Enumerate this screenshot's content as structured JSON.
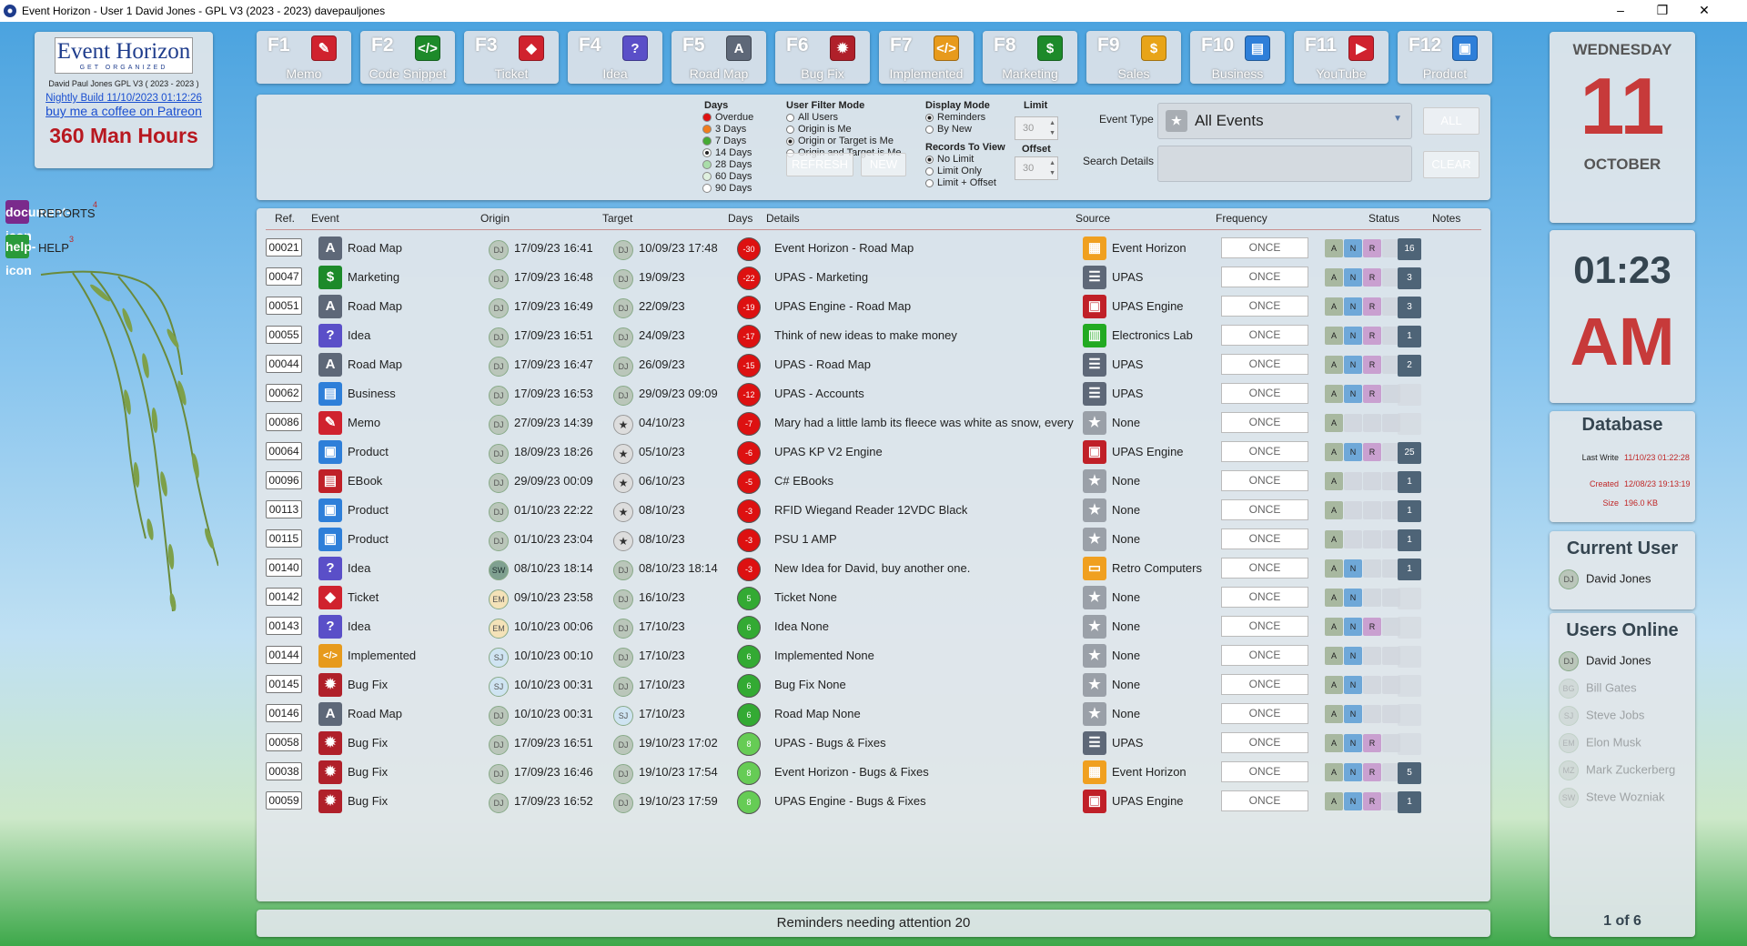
{
  "window": {
    "title": "Event Horizon - User 1 David Jones - GPL V3 (2023 - 2023) davepauljones"
  },
  "logo": {
    "title": "Event Horizon",
    "tagline": "GET ORGANIZED",
    "license": "David Paul Jones GPL V3 ( 2023 - 2023 )",
    "nightly": "Nightly Build 11/10/2023 01:12:26",
    "patreon": "buy me a coffee on Patreon",
    "hours": "360 Man Hours"
  },
  "leftnav": [
    {
      "label": "REPORTS",
      "count": "4",
      "color": "#7a2a8c",
      "icon": "document-icon"
    },
    {
      "label": "HELP",
      "count": "3",
      "color": "#2a9a3a",
      "icon": "help-icon"
    }
  ],
  "fkeys": [
    {
      "key": "F1",
      "label": "Memo",
      "color": "#d0222e",
      "glyph": "✎"
    },
    {
      "key": "F2",
      "label": "Code Snippet",
      "color": "#1d8a2a",
      "glyph": "</>"
    },
    {
      "key": "F3",
      "label": "Ticket",
      "color": "#d0222e",
      "glyph": "◆"
    },
    {
      "key": "F4",
      "label": "Idea",
      "color": "#5a4fc8",
      "glyph": "?"
    },
    {
      "key": "F5",
      "label": "Road Map",
      "color": "#5e6878",
      "glyph": "A"
    },
    {
      "key": "F6",
      "label": "Bug Fix",
      "color": "#b0202a",
      "glyph": "✹"
    },
    {
      "key": "F7",
      "label": "Implemented",
      "color": "#e79a1c",
      "glyph": "</>"
    },
    {
      "key": "F8",
      "label": "Marketing",
      "color": "#1d8a2a",
      "glyph": "$"
    },
    {
      "key": "F9",
      "label": "Sales",
      "color": "#e8a418",
      "glyph": "$"
    },
    {
      "key": "F10",
      "label": "Business",
      "color": "#2e7fd9",
      "glyph": "▤"
    },
    {
      "key": "F11",
      "label": "YouTube",
      "color": "#d0222e",
      "glyph": "▶"
    },
    {
      "key": "F12",
      "label": "Product",
      "color": "#2e7fd9",
      "glyph": "▣"
    }
  ],
  "filters": {
    "days_title": "Days",
    "days": [
      {
        "label": "Overdue",
        "color": "#dd1111"
      },
      {
        "label": "3 Days",
        "color": "#f07c1c"
      },
      {
        "label": "7 Days",
        "color": "#44aa33"
      },
      {
        "label": "14 Days",
        "color": "#66cc55",
        "selected": true
      },
      {
        "label": "28 Days",
        "color": "#aaddaa"
      },
      {
        "label": "60 Days",
        "color": "#dff0df"
      },
      {
        "label": "90 Days",
        "color": "#ffffff"
      }
    ],
    "user_filter_title": "User Filter Mode",
    "user_filter": [
      {
        "label": "All Users"
      },
      {
        "label": "Origin is Me"
      },
      {
        "label": "Origin or Target is Me",
        "selected": true
      },
      {
        "label": "Origin and Target is Me"
      }
    ],
    "display_title": "Display Mode",
    "display": [
      {
        "label": "Reminders",
        "selected": true
      },
      {
        "label": "By New"
      }
    ],
    "records_title": "Records To View",
    "records": [
      {
        "label": "No Limit",
        "selected": true
      },
      {
        "label": "Limit Only"
      },
      {
        "label": "Limit + Offset"
      }
    ],
    "limit_title": "Limit",
    "limit_value": "30",
    "offset_title": "Offset",
    "offset_value": "30",
    "refresh": "REFRESH",
    "new": "NEW",
    "event_type_label": "Event Type",
    "event_type_value": "All Events",
    "all_button": "ALL",
    "search_label": "Search Details",
    "search_value": "",
    "clear_button": "CLEAR"
  },
  "columns": [
    "Ref.",
    "Event",
    "Origin",
    "Target",
    "Days",
    "Details",
    "Source",
    "Frequency",
    "Status",
    "Notes"
  ],
  "rows": [
    {
      "ref": "00021",
      "event": "Road Map",
      "ecol": "#5e6878",
      "eg": "A",
      "origin": "17/09/23 16:41",
      "oav": "DJ",
      "target": "10/09/23 17:48",
      "tav": "DJ",
      "days": "-30",
      "dcol": "#dd1111",
      "details": "Event Horizon - Road Map",
      "source": "Event Horizon",
      "scol": "#f0a020",
      "sg": "▦",
      "freq": "ONCE",
      "a": 1,
      "n": 1,
      "r": 1,
      "notes": "16"
    },
    {
      "ref": "00047",
      "event": "Marketing",
      "ecol": "#1d8a2a",
      "eg": "$",
      "origin": "17/09/23 16:48",
      "oav": "DJ",
      "target": "19/09/23",
      "tav": "DJ",
      "days": "-22",
      "dcol": "#dd1111",
      "details": "UPAS - Marketing",
      "source": "UPAS",
      "scol": "#5e6878",
      "sg": "☰",
      "freq": "ONCE",
      "a": 1,
      "n": 1,
      "r": 1,
      "notes": "3"
    },
    {
      "ref": "00051",
      "event": "Road Map",
      "ecol": "#5e6878",
      "eg": "A",
      "origin": "17/09/23 16:49",
      "oav": "DJ",
      "target": "22/09/23",
      "tav": "DJ",
      "days": "-19",
      "dcol": "#dd1111",
      "details": "UPAS Engine - Road Map",
      "source": "UPAS Engine",
      "scol": "#c02028",
      "sg": "▣",
      "freq": "ONCE",
      "a": 1,
      "n": 1,
      "r": 1,
      "notes": "3"
    },
    {
      "ref": "00055",
      "event": "Idea",
      "ecol": "#5a4fc8",
      "eg": "?",
      "origin": "17/09/23 16:51",
      "oav": "DJ",
      "target": "24/09/23",
      "tav": "DJ",
      "days": "-17",
      "dcol": "#dd1111",
      "details": "Think of new ideas to make money",
      "source": "Electronics Lab",
      "scol": "#22aa22",
      "sg": "▥",
      "freq": "ONCE",
      "a": 1,
      "n": 1,
      "r": 1,
      "notes": "1"
    },
    {
      "ref": "00044",
      "event": "Road Map",
      "ecol": "#5e6878",
      "eg": "A",
      "origin": "17/09/23 16:47",
      "oav": "DJ",
      "target": "26/09/23",
      "tav": "DJ",
      "days": "-15",
      "dcol": "#dd1111",
      "details": "UPAS - Road Map",
      "source": "UPAS",
      "scol": "#5e6878",
      "sg": "☰",
      "freq": "ONCE",
      "a": 1,
      "n": 1,
      "r": 1,
      "notes": "2"
    },
    {
      "ref": "00062",
      "event": "Business",
      "ecol": "#2e7fd9",
      "eg": "▤",
      "origin": "17/09/23 16:53",
      "oav": "DJ",
      "target": "29/09/23 09:09",
      "tav": "DJ",
      "days": "-12",
      "dcol": "#dd1111",
      "details": "UPAS - Accounts",
      "source": "UPAS",
      "scol": "#5e6878",
      "sg": "☰",
      "freq": "ONCE",
      "a": 1,
      "n": 1,
      "r": 1,
      "notes": ""
    },
    {
      "ref": "00086",
      "event": "Memo",
      "ecol": "#d0222e",
      "eg": "✎",
      "origin": "27/09/23 14:39",
      "oav": "DJ",
      "target": "04/10/23",
      "tav": "★",
      "days": "-7",
      "dcol": "#dd1111",
      "details": "Mary had a little lamb its fleece was white as snow, every",
      "source": "None",
      "scol": "#9aa0a8",
      "sg": "★",
      "freq": "ONCE",
      "a": 1,
      "n": 0,
      "r": 0,
      "notes": ""
    },
    {
      "ref": "00064",
      "event": "Product",
      "ecol": "#2e7fd9",
      "eg": "▣",
      "origin": "18/09/23 18:26",
      "oav": "DJ",
      "target": "05/10/23",
      "tav": "★",
      "days": "-6",
      "dcol": "#dd1111",
      "details": "UPAS KP V2 Engine",
      "source": "UPAS Engine",
      "scol": "#c02028",
      "sg": "▣",
      "freq": "ONCE",
      "a": 1,
      "n": 1,
      "r": 1,
      "notes": "25"
    },
    {
      "ref": "00096",
      "event": "EBook",
      "ecol": "#c02028",
      "eg": "▤",
      "origin": "29/09/23 00:09",
      "oav": "DJ",
      "target": "06/10/23",
      "tav": "★",
      "days": "-5",
      "dcol": "#dd1111",
      "details": "C# EBooks",
      "source": "None",
      "scol": "#9aa0a8",
      "sg": "★",
      "freq": "ONCE",
      "a": 1,
      "n": 0,
      "r": 0,
      "notes": "1"
    },
    {
      "ref": "00113",
      "event": "Product",
      "ecol": "#2e7fd9",
      "eg": "▣",
      "origin": "01/10/23 22:22",
      "oav": "DJ",
      "target": "08/10/23",
      "tav": "★",
      "days": "-3",
      "dcol": "#dd1111",
      "details": "RFID Wiegand Reader 12VDC Black",
      "source": "None",
      "scol": "#9aa0a8",
      "sg": "★",
      "freq": "ONCE",
      "a": 1,
      "n": 0,
      "r": 0,
      "notes": "1"
    },
    {
      "ref": "00115",
      "event": "Product",
      "ecol": "#2e7fd9",
      "eg": "▣",
      "origin": "01/10/23 23:04",
      "oav": "DJ",
      "target": "08/10/23",
      "tav": "★",
      "days": "-3",
      "dcol": "#dd1111",
      "details": "PSU 1 AMP",
      "source": "None",
      "scol": "#9aa0a8",
      "sg": "★",
      "freq": "ONCE",
      "a": 1,
      "n": 0,
      "r": 0,
      "notes": "1"
    },
    {
      "ref": "00140",
      "event": "Idea",
      "ecol": "#5a4fc8",
      "eg": "?",
      "origin": "08/10/23 18:14",
      "oav": "SW",
      "target": "08/10/23 18:14",
      "tav": "DJ",
      "days": "-3",
      "dcol": "#dd1111",
      "details": "New Idea for David, buy another one.",
      "source": "Retro Computers",
      "scol": "#f0a020",
      "sg": "▭",
      "freq": "ONCE",
      "a": 1,
      "n": 1,
      "r": 0,
      "notes": "1"
    },
    {
      "ref": "00142",
      "event": "Ticket",
      "ecol": "#d0222e",
      "eg": "◆",
      "origin": "09/10/23 23:58",
      "oav": "EM",
      "target": "16/10/23",
      "tav": "DJ",
      "days": "5",
      "dcol": "#33aa33",
      "details": "Ticket None",
      "source": "None",
      "scol": "#9aa0a8",
      "sg": "★",
      "freq": "ONCE",
      "a": 1,
      "n": 1,
      "r": 0,
      "notes": ""
    },
    {
      "ref": "00143",
      "event": "Idea",
      "ecol": "#5a4fc8",
      "eg": "?",
      "origin": "10/10/23 00:06",
      "oav": "EM",
      "target": "17/10/23",
      "tav": "DJ",
      "days": "6",
      "dcol": "#33aa33",
      "details": "Idea None",
      "source": "None",
      "scol": "#9aa0a8",
      "sg": "★",
      "freq": "ONCE",
      "a": 1,
      "n": 1,
      "r": 1,
      "notes": ""
    },
    {
      "ref": "00144",
      "event": "Implemented",
      "ecol": "#e79a1c",
      "eg": "</>",
      "origin": "10/10/23 00:10",
      "oav": "SJ",
      "target": "17/10/23",
      "tav": "DJ",
      "days": "6",
      "dcol": "#33aa33",
      "details": "Implemented None",
      "source": "None",
      "scol": "#9aa0a8",
      "sg": "★",
      "freq": "ONCE",
      "a": 1,
      "n": 1,
      "r": 0,
      "notes": ""
    },
    {
      "ref": "00145",
      "event": "Bug Fix",
      "ecol": "#b0202a",
      "eg": "✹",
      "origin": "10/10/23 00:31",
      "oav": "SJ",
      "target": "17/10/23",
      "tav": "DJ",
      "days": "6",
      "dcol": "#33aa33",
      "details": "Bug Fix None",
      "source": "None",
      "scol": "#9aa0a8",
      "sg": "★",
      "freq": "ONCE",
      "a": 1,
      "n": 1,
      "r": 0,
      "notes": ""
    },
    {
      "ref": "00146",
      "event": "Road Map",
      "ecol": "#5e6878",
      "eg": "A",
      "origin": "10/10/23 00:31",
      "oav": "DJ",
      "target": "17/10/23",
      "tav": "SJ",
      "days": "6",
      "dcol": "#33aa33",
      "details": "Road Map None",
      "source": "None",
      "scol": "#9aa0a8",
      "sg": "★",
      "freq": "ONCE",
      "a": 1,
      "n": 1,
      "r": 0,
      "notes": ""
    },
    {
      "ref": "00058",
      "event": "Bug Fix",
      "ecol": "#b0202a",
      "eg": "✹",
      "origin": "17/09/23 16:51",
      "oav": "DJ",
      "target": "19/10/23 17:02",
      "tav": "DJ",
      "days": "8",
      "dcol": "#66cc55",
      "details": "UPAS - Bugs & Fixes",
      "source": "UPAS",
      "scol": "#5e6878",
      "sg": "☰",
      "freq": "ONCE",
      "a": 1,
      "n": 1,
      "r": 1,
      "notes": ""
    },
    {
      "ref": "00038",
      "event": "Bug Fix",
      "ecol": "#b0202a",
      "eg": "✹",
      "origin": "17/09/23 16:46",
      "oav": "DJ",
      "target": "19/10/23 17:54",
      "tav": "DJ",
      "days": "8",
      "dcol": "#66cc55",
      "details": "Event Horizon - Bugs & Fixes",
      "source": "Event Horizon",
      "scol": "#f0a020",
      "sg": "▦",
      "freq": "ONCE",
      "a": 1,
      "n": 1,
      "r": 1,
      "notes": "5"
    },
    {
      "ref": "00059",
      "event": "Bug Fix",
      "ecol": "#b0202a",
      "eg": "✹",
      "origin": "17/09/23 16:52",
      "oav": "DJ",
      "target": "19/10/23 17:59",
      "tav": "DJ",
      "days": "8",
      "dcol": "#66cc55",
      "details": "UPAS Engine - Bugs & Fixes",
      "source": "UPAS Engine",
      "scol": "#c02028",
      "sg": "▣",
      "freq": "ONCE",
      "a": 1,
      "n": 1,
      "r": 1,
      "notes": "1"
    }
  ],
  "status_letters": {
    "a": "A",
    "n": "N",
    "r": "R"
  },
  "footer": {
    "text": "Reminders needing attention 20"
  },
  "calendar": {
    "weekday": "WEDNESDAY",
    "day": "11",
    "month": "OCTOBER"
  },
  "clock": {
    "time": "01:23",
    "ampm": "AM"
  },
  "database": {
    "title": "Database",
    "last_write_label": "Last Write",
    "last_write": "11/10/23 01:22:28",
    "created_label": "Created",
    "created": "12/08/23 19:13:19",
    "size_label": "Size",
    "size": "196.0 KB"
  },
  "current_user": {
    "title": "Current User",
    "initials": "DJ",
    "name": "David Jones"
  },
  "users_online": {
    "title": "Users Online",
    "users": [
      {
        "initials": "DJ",
        "name": "David Jones",
        "online": true
      },
      {
        "initials": "BG",
        "name": "Bill Gates",
        "online": false
      },
      {
        "initials": "SJ",
        "name": "Steve Jobs",
        "online": false
      },
      {
        "initials": "EM",
        "name": "Elon Musk",
        "online": false
      },
      {
        "initials": "MZ",
        "name": "Mark Zuckerberg",
        "online": false
      },
      {
        "initials": "SW",
        "name": "Steve Wozniak",
        "online": false
      }
    ],
    "page": "1 of 6"
  }
}
